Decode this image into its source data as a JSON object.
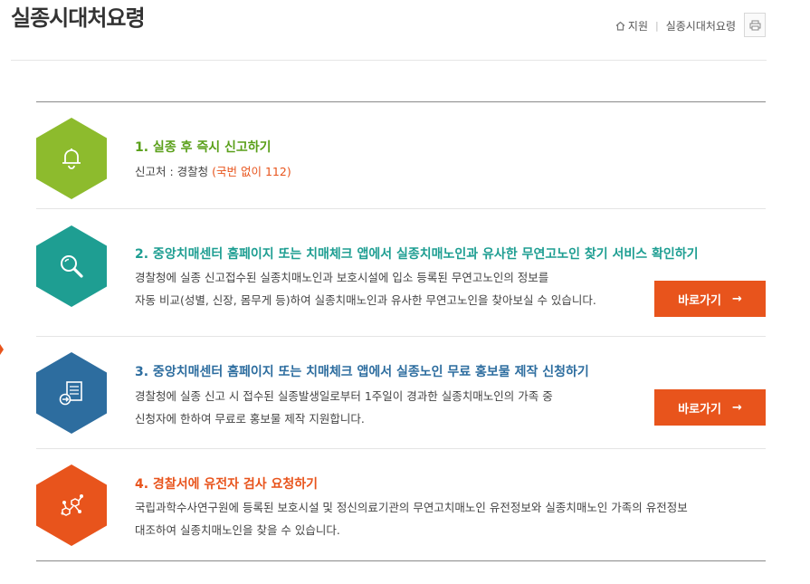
{
  "page": {
    "title": "실종시대처요령"
  },
  "breadcrumb": {
    "home_label": "지원",
    "current": "실종시대처요령"
  },
  "colors": {
    "accent": "#e8541c",
    "step1": "#8dbb2d",
    "step2": "#1e9e92",
    "step3": "#2d6d9f",
    "step4": "#e8541c",
    "title1": "#5aa01a",
    "title2": "#1e9e92",
    "title3": "#2d6d9f",
    "title4": "#e8541c"
  },
  "steps": [
    {
      "icon": "bell-icon",
      "title": "1. 실종 후 즉시 신고하기",
      "desc_prefix": "신고처 : 경찰청 ",
      "desc_highlight": "(국번 없이 112)"
    },
    {
      "icon": "magnifier-icon",
      "title": "2. 중앙치매센터 홈페이지 또는 치매체크 앱에서 실종치매노인과 유사한 무연고노인 찾기 서비스 확인하기",
      "desc_line1": "경찰청에 실종 신고접수된 실종치매노인과 보호시설에 입소 등록된 무연고노인의 정보를",
      "desc_line2": "자동 비교(성별, 신장, 몸무게 등)하여 실종치매노인과 유사한 무연고노인을 찾아보실 수 있습니다.",
      "button_label": "바로가기",
      "button_arrow": "→"
    },
    {
      "icon": "document-icon",
      "title": "3. 중앙치매센터 홈페이지 또는 치매체크 앱에서 실종노인 무료 홍보물 제작 신청하기",
      "desc_line1": "경찰청에 실종 신고 시 접수된 실종발생일로부터 1주일이 경과한 실종치매노인의 가족 중",
      "desc_line2": "신청자에 한하여 무료로 홍보물 제작 지원합니다.",
      "button_label": "바로가기",
      "button_arrow": "→"
    },
    {
      "icon": "molecule-icon",
      "title": "4. 경찰서에 유전자 검사 요청하기",
      "desc_line1": "국립과학수사연구원에 등록된 보호시설 및 정신의료기관의 무연고치매노인 유전정보와 실종치매노인 가족의 유전정보",
      "desc_line2": "대조하여 실종치매노인을 찾을 수 있습니다."
    }
  ]
}
